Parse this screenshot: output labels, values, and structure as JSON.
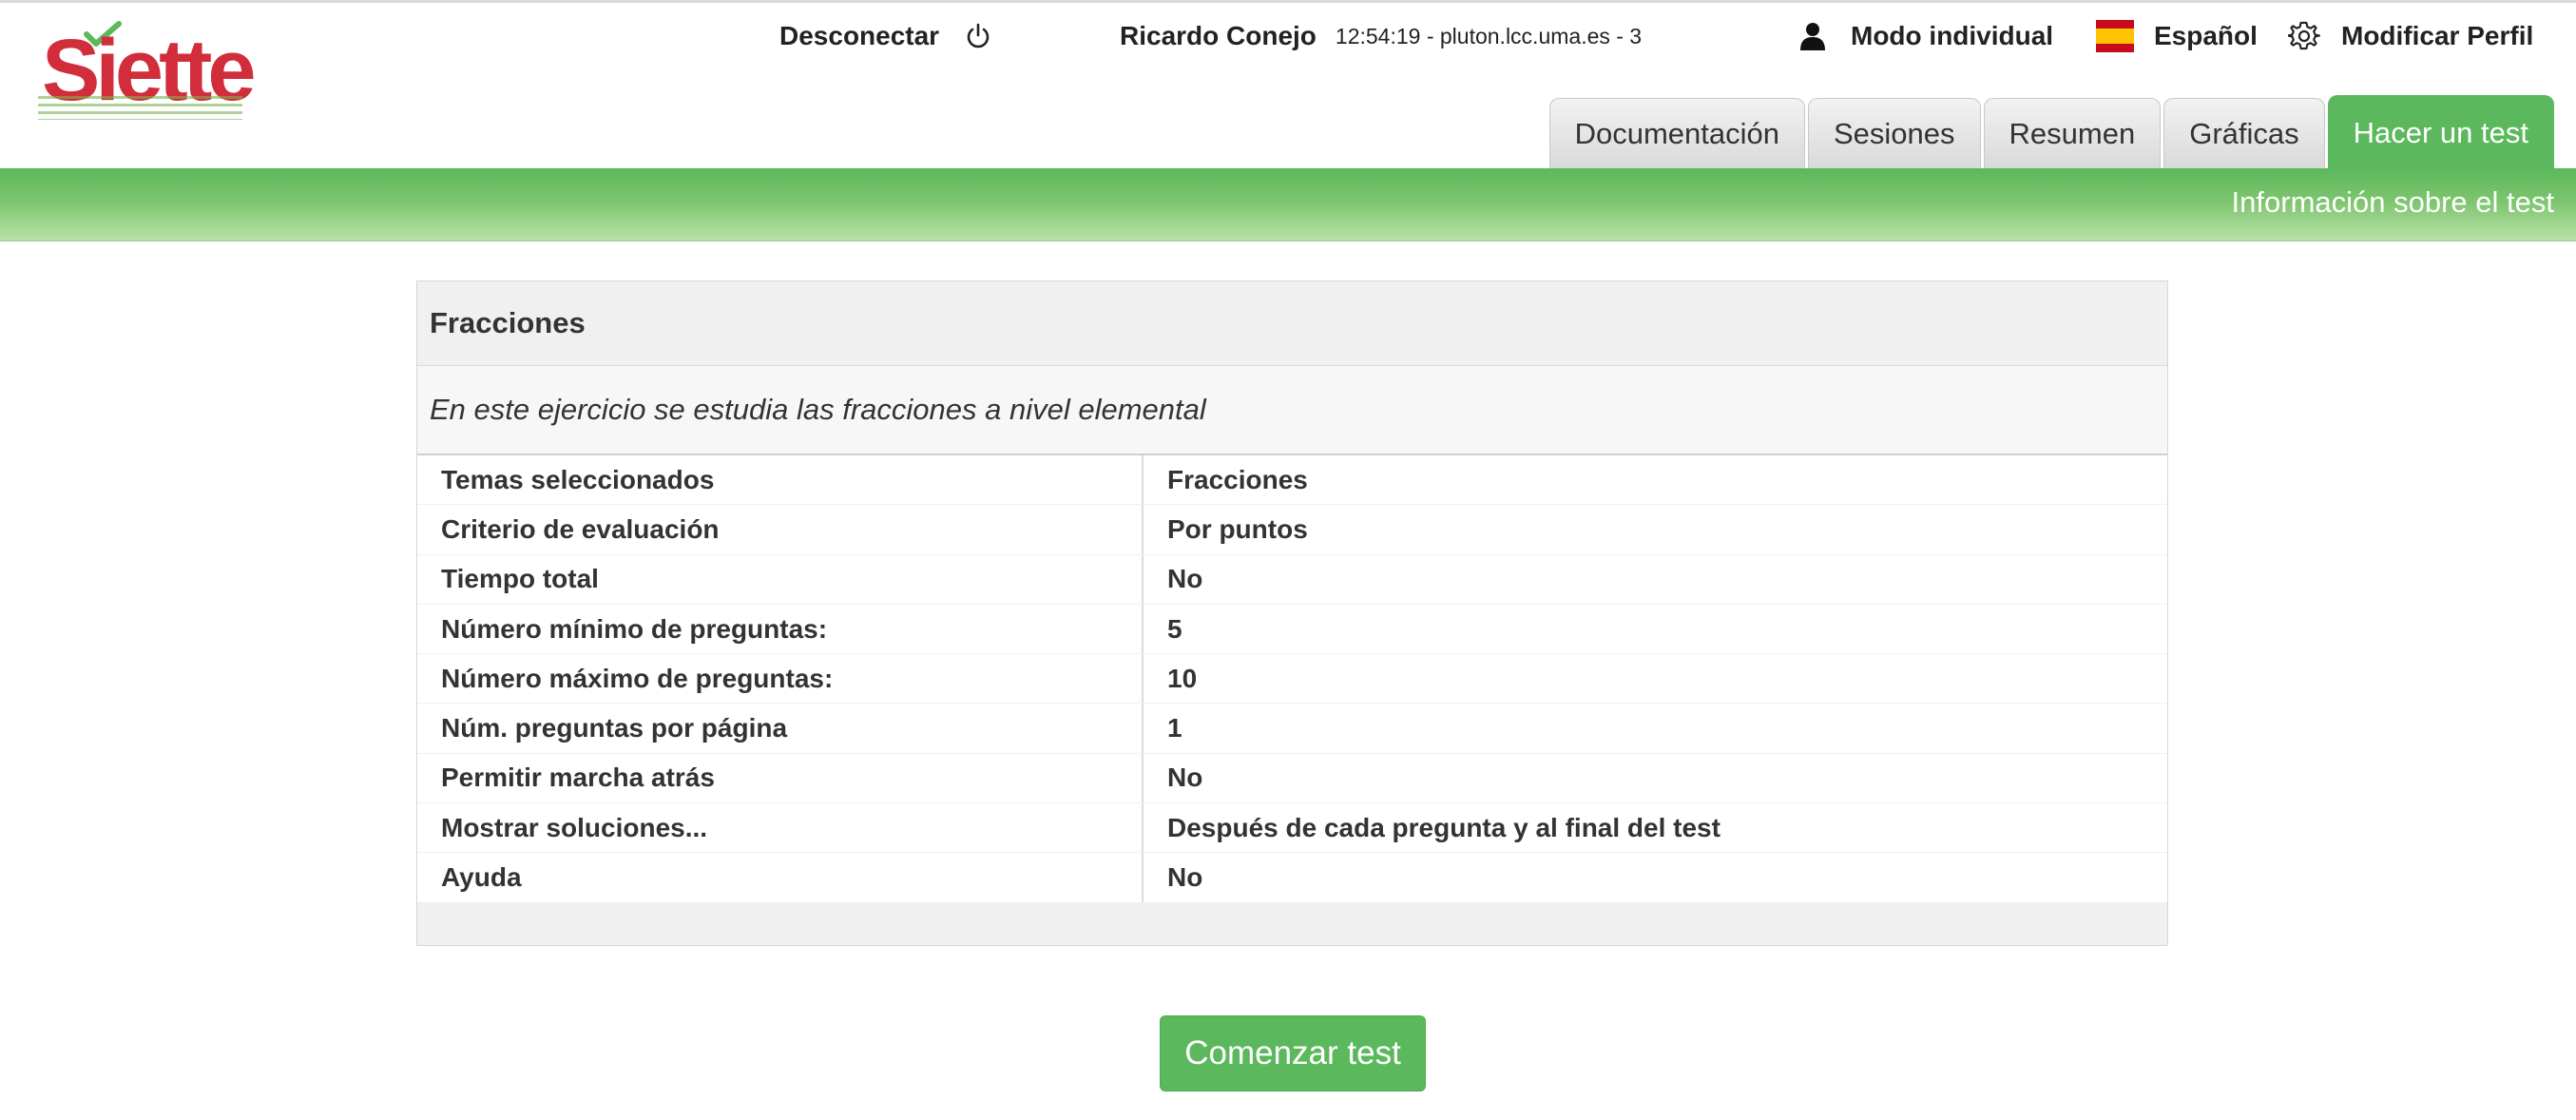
{
  "logo": {
    "text": "Siette"
  },
  "header": {
    "disconnect_label": "Desconectar",
    "user_name": "Ricardo Conejo",
    "session_info": "12:54:19 - pluton.lcc.uma.es - 3",
    "mode_label": "Modo individual",
    "language_label": "Español",
    "profile_label": "Modificar Perfil"
  },
  "tabs": [
    {
      "label": "Documentación",
      "active": false
    },
    {
      "label": "Sesiones",
      "active": false
    },
    {
      "label": "Resumen",
      "active": false
    },
    {
      "label": "Gráficas",
      "active": false
    },
    {
      "label": "Hacer un test",
      "active": true
    }
  ],
  "band": {
    "text": "Información sobre el test"
  },
  "test": {
    "title": "Fracciones",
    "description": "En este ejercicio se estudia las fracciones a nivel elemental",
    "rows": [
      {
        "key": "Temas seleccionados",
        "value": "Fracciones"
      },
      {
        "key": "Criterio de evaluación",
        "value": "Por puntos"
      },
      {
        "key": "Tiempo total",
        "value": "No"
      },
      {
        "key": "Número mínimo de preguntas:",
        "value": "5"
      },
      {
        "key": "Número máximo de preguntas:",
        "value": "10"
      },
      {
        "key": "Núm. preguntas por página",
        "value": "1"
      },
      {
        "key": "Permitir marcha atrás",
        "value": "No"
      },
      {
        "key": "Mostrar soluciones...",
        "value": "Después de cada pregunta y al final del test"
      },
      {
        "key": "Ayuda",
        "value": "No"
      }
    ]
  },
  "start_button": {
    "label": "Comenzar test"
  },
  "colors": {
    "accent_green": "#5cb85c",
    "logo_red": "#d12d3a",
    "flag_red": "#c60b1e",
    "flag_yellow": "#ffc400"
  },
  "icons": {
    "disconnect": "power-icon",
    "user": "user-icon",
    "language": "spain-flag-icon",
    "profile": "gear-icon"
  }
}
